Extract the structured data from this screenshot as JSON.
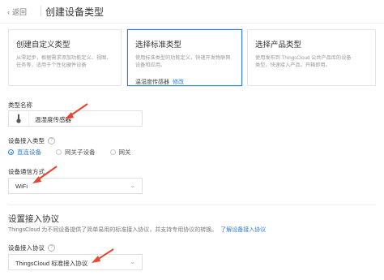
{
  "header": {
    "back_label": "返回",
    "title": "创建设备类型"
  },
  "cards": [
    {
      "title": "创建自定义类型",
      "desc_lines": [
        "从零起步，根据需求添加功能定义、视图、",
        "任务等，适用于个性化硬件设备"
      ],
      "selected": false
    },
    {
      "title": "选择标准类型",
      "desc_lines": [
        "使用标准类型的功能定义，快速开发物联网",
        "设备和应用。"
      ],
      "selected_label": "温湿度传感器",
      "edit_label": "修改",
      "selected": true
    },
    {
      "title": "选择产品类型",
      "desc_lines": [
        "使用发布到 ThingsCloud 公共产品库的设备",
        "类型，快速接入产品，开箱即用。"
      ],
      "selected": false
    }
  ],
  "form": {
    "type_name_label": "类型名称",
    "type_name_value": "温湿度传感器",
    "access_type_label": "设备接入类型",
    "access_options": [
      "直连设备",
      "网关子设备",
      "网关"
    ],
    "access_selected": "直连设备",
    "comm_label": "设备通信方式",
    "comm_value": "WiFi"
  },
  "protocol": {
    "section_title": "设置接入协议",
    "section_desc": "ThingsCloud 为不同设备提供了简单易用的标准接入协议，并支持专用协议的转换。",
    "section_link": "了解设备接入协议",
    "label": "设备接入协议",
    "value": "ThingsCloud 标准接入协议"
  },
  "colors": {
    "accent": "#2f7de1",
    "annotation_arrow": "#e8452c"
  }
}
